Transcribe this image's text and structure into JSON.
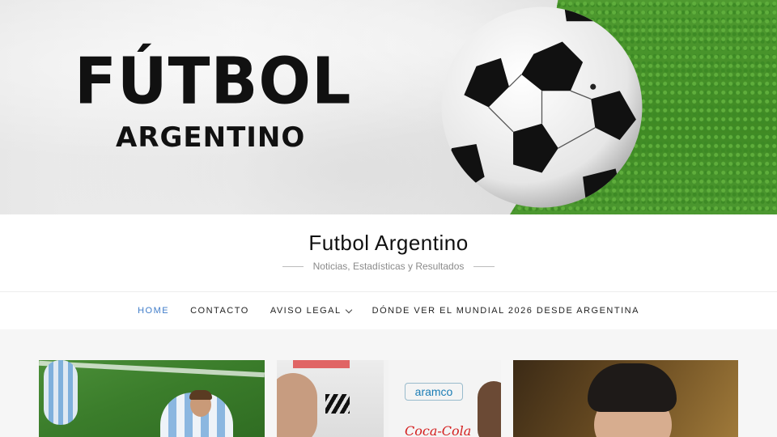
{
  "banner": {
    "title": "FÚTBOL",
    "subtitle": "ARGENTINO"
  },
  "site": {
    "title": "Futbol Argentino",
    "tagline": "Noticias, Estadísticas y Resultados"
  },
  "nav": {
    "items": [
      {
        "label": "HOME",
        "active": true
      },
      {
        "label": "CONTACTO",
        "active": false
      },
      {
        "label": "AVISO LEGAL",
        "active": false,
        "has_dropdown": true
      },
      {
        "label": "DÓNDE VER EL MUNDIAL 2026 DESDE ARGENTINA",
        "active": false
      }
    ]
  },
  "cards": {
    "card2_sponsor1": "aramco",
    "card2_sponsor2": "Coca-Cola"
  },
  "colors": {
    "accent": "#3f7cc9",
    "grass": "#4f9a30"
  }
}
